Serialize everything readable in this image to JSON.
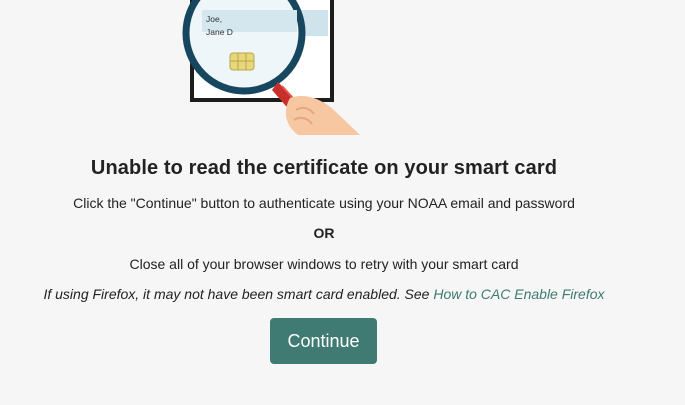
{
  "card": {
    "name_line1": "Joe,",
    "name_line2": "Jane D"
  },
  "icons": {
    "illustration": "magnifier-over-smart-card-icon"
  },
  "message": {
    "title": "Unable to read the certificate on your smart card",
    "continue_instruction": "Click the \"Continue\" button to authenticate using your NOAA email and password",
    "or_text": "OR",
    "retry_instruction": "Close all of your browser windows to retry with your smart card",
    "firefox_note": "If using Firefox, it may not have been smart card enabled. See ",
    "firefox_link": "How to CAC Enable Firefox"
  },
  "actions": {
    "continue_label": "Continue"
  },
  "colors": {
    "background": "#f6f6f6",
    "accent": "#3f7b72",
    "link": "#3d7a70"
  }
}
